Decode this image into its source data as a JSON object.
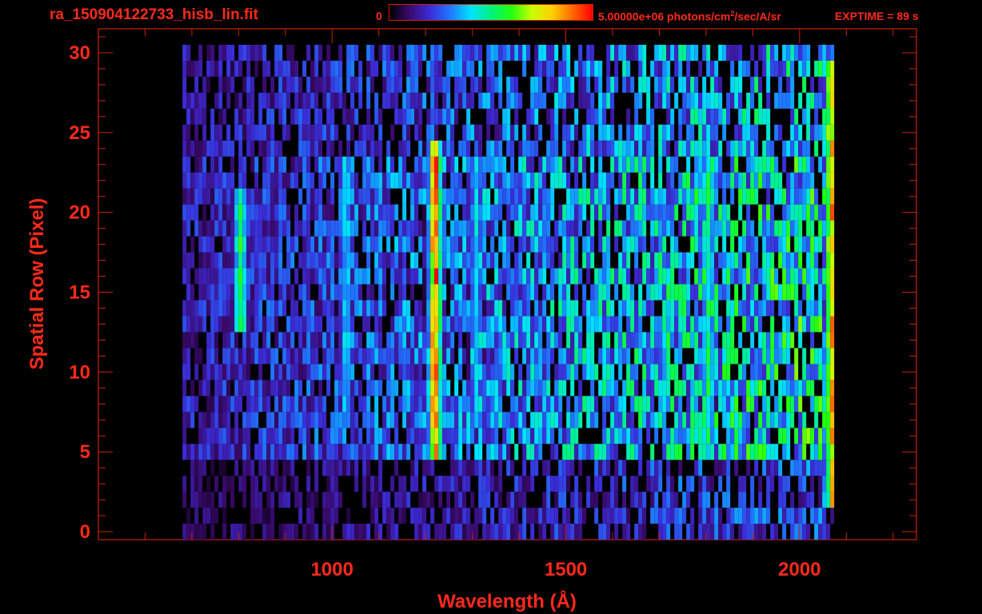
{
  "header": {
    "file_title": "ra_150904122733_hisb_lin.fit",
    "colorbar_min": "0",
    "colorbar_max_value": "5.00000e+06",
    "colorbar_units_pre": " photons/cm",
    "colorbar_units_exp": "2",
    "colorbar_units_post": "/sec/A/sr",
    "exptime": "EXPTIME = 89 s"
  },
  "colors": {
    "text": "#ff2a1a",
    "axes": "#cc2200",
    "background": "#000000",
    "colormap": [
      "#000000",
      "#3a0a6e",
      "#3b2cd8",
      "#1e78ff",
      "#00e2ff",
      "#00f280",
      "#20ff10",
      "#c8ff00",
      "#ffd000",
      "#ff6a00",
      "#ff0000"
    ]
  },
  "chart_data": {
    "type": "heatmap",
    "colormap": "rainbow",
    "title": "",
    "xlabel": "Wavelength (Å)",
    "ylabel": "Spatial Row (Pixel)",
    "xlim": [
      500,
      2250
    ],
    "ylim": [
      -0.5,
      31.5
    ],
    "x_ticks": [
      1000,
      1500,
      2000
    ],
    "y_ticks": [
      0,
      5,
      10,
      15,
      20,
      25,
      30
    ],
    "grid": false,
    "z_range": [
      0,
      5000000
    ],
    "z_units": "photons/cm^2/sec/A/sr",
    "detector_range_wavelength": [
      680,
      2070
    ],
    "signal_rows": [
      5,
      23
    ],
    "emission_features": [
      {
        "wavelength": 800,
        "rows": [
          13,
          21
        ],
        "intensity": 0.6
      },
      {
        "wavelength": 1026,
        "rows": [
          7,
          23
        ],
        "intensity": 0.42
      },
      {
        "wavelength": 1216,
        "rows": [
          5,
          24
        ],
        "intensity": 0.95
      },
      {
        "wavelength": 1304,
        "rows": [
          7,
          23
        ],
        "intensity": 0.4
      },
      {
        "wavelength": 1800,
        "rows": [
          6,
          23
        ],
        "intensity": 0.52
      },
      {
        "wavelength": 2065,
        "rows": [
          2,
          29
        ],
        "intensity": 0.85
      }
    ],
    "continuum_gradient": {
      "start_wavelength": 680,
      "start_level": 0.2,
      "end_wavelength": 2070,
      "end_level": 0.55
    }
  }
}
